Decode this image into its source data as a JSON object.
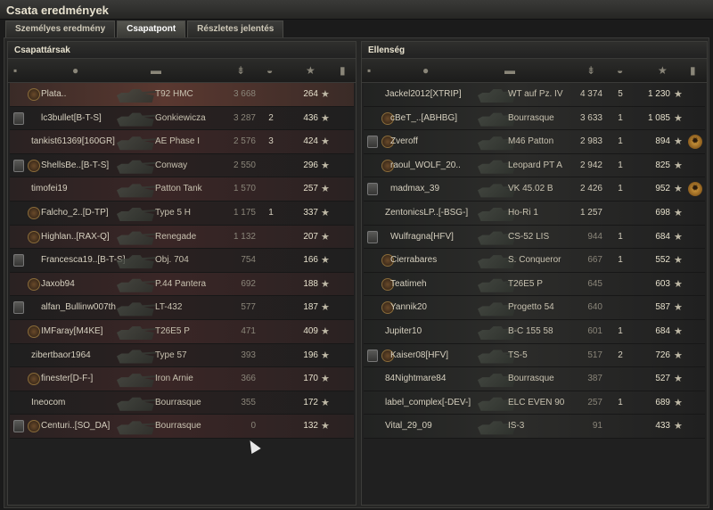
{
  "window": {
    "title": "Csata eredmények"
  },
  "tabs": [
    {
      "label": "Személyes eredmény",
      "active": false
    },
    {
      "label": "Csapatpont",
      "active": true
    },
    {
      "label": "Részletes jelentés",
      "active": false
    }
  ],
  "icons": {
    "platoon": "platoon-icon",
    "player": "player-icon",
    "tank": "tank-icon",
    "damage": "damage-icon",
    "kills": "kills-icon",
    "xp": "star-icon",
    "medal": "medal-icon"
  },
  "allies": {
    "title": "Csapattársak",
    "rows": [
      {
        "name": "Plata..",
        "tank": "T92 HMC",
        "damage": "3 668",
        "kills": "",
        "xp": "264",
        "platoon": false,
        "clan": true,
        "player": true
      },
      {
        "name": "lc3bullet[B-T-S]",
        "tank": "Gonkiewicza",
        "damage": "3 287",
        "kills": "2",
        "xp": "436",
        "platoon": true,
        "clan": false
      },
      {
        "name": "tankist61369[160GR]",
        "tank": "AE Phase I",
        "damage": "2 576",
        "kills": "3",
        "xp": "424",
        "platoon": false,
        "clan": false
      },
      {
        "name": "ShellsBe..[B-T-S]",
        "tank": "Conway",
        "damage": "2 550",
        "kills": "",
        "xp": "296",
        "platoon": true,
        "clan": true
      },
      {
        "name": "timofei19",
        "tank": "Patton Tank",
        "damage": "1 570",
        "kills": "",
        "xp": "257",
        "platoon": false,
        "clan": false
      },
      {
        "name": "Falcho_2..[D-TP]",
        "tank": "Type 5 H",
        "damage": "1 175",
        "kills": "1",
        "xp": "337",
        "platoon": false,
        "clan": true
      },
      {
        "name": "Highlan..[RAX-Q]",
        "tank": "Renegade",
        "damage": "1 132",
        "kills": "",
        "xp": "207",
        "platoon": false,
        "clan": true
      },
      {
        "name": "Francesca19..[B-T-S]",
        "tank": "Obj. 704",
        "damage": "754",
        "kills": "",
        "xp": "166",
        "platoon": true,
        "clan": false
      },
      {
        "name": "Jaxob94",
        "tank": "P.44 Pantera",
        "damage": "692",
        "kills": "",
        "xp": "188",
        "platoon": false,
        "clan": true
      },
      {
        "name": "alfan_Bullinw007th",
        "tank": "LT-432",
        "damage": "577",
        "kills": "",
        "xp": "187",
        "platoon": true,
        "clan": false
      },
      {
        "name": "IMFaray[M4KE]",
        "tank": "T26E5 P",
        "damage": "471",
        "kills": "",
        "xp": "409",
        "platoon": false,
        "clan": true
      },
      {
        "name": "zibertbaor1964",
        "tank": "Type 57",
        "damage": "393",
        "kills": "",
        "xp": "196",
        "platoon": false,
        "clan": false
      },
      {
        "name": "finester[D-F-]",
        "tank": "Iron Arnie",
        "damage": "366",
        "kills": "",
        "xp": "170",
        "platoon": false,
        "clan": true
      },
      {
        "name": "Ineocom",
        "tank": "Bourrasque",
        "damage": "355",
        "kills": "",
        "xp": "172",
        "platoon": false,
        "clan": false
      },
      {
        "name": "Centuri..[SO_DA]",
        "tank": "Bourrasque",
        "damage": "0",
        "kills": "",
        "xp": "132",
        "platoon": true,
        "clan": true
      }
    ]
  },
  "enemies": {
    "title": "Ellenség",
    "rows": [
      {
        "name": "Jackel2012[XTRIP]",
        "tank": "WT auf Pz. IV",
        "damage": "4 374",
        "kills": "5",
        "xp": "1 230",
        "platoon": false,
        "clan": false,
        "medal": false
      },
      {
        "name": "cBeT_..[ABHBG]",
        "tank": "Bourrasque",
        "damage": "3 633",
        "kills": "1",
        "xp": "1 085",
        "platoon": false,
        "clan": true,
        "medal": false
      },
      {
        "name": "Zveroff",
        "tank": "M46 Patton",
        "damage": "2 983",
        "kills": "1",
        "xp": "894",
        "platoon": true,
        "clan": true,
        "medal": true
      },
      {
        "name": "raoul_WOLF_20..",
        "tank": "Leopard PT A",
        "damage": "2 942",
        "kills": "1",
        "xp": "825",
        "platoon": false,
        "clan": true,
        "medal": false
      },
      {
        "name": "madmax_39",
        "tank": "VK 45.02 B",
        "damage": "2 426",
        "kills": "1",
        "xp": "952",
        "platoon": true,
        "clan": false,
        "medal": true
      },
      {
        "name": "ZentonicsLP..[-BSG-]",
        "tank": "Ho-Ri 1",
        "damage": "1 257",
        "kills": "",
        "xp": "698",
        "platoon": false,
        "clan": false,
        "medal": false
      },
      {
        "name": "Wulfragna[HFV]",
        "tank": "CS-52 LIS",
        "damage": "944",
        "kills": "1",
        "xp": "684",
        "platoon": true,
        "clan": false,
        "medal": false
      },
      {
        "name": "Cierrabares",
        "tank": "S. Conqueror",
        "damage": "667",
        "kills": "1",
        "xp": "552",
        "platoon": false,
        "clan": true,
        "medal": false
      },
      {
        "name": "Teatimeh",
        "tank": "T26E5 P",
        "damage": "645",
        "kills": "",
        "xp": "603",
        "platoon": false,
        "clan": true,
        "medal": false
      },
      {
        "name": "Yannik20",
        "tank": "Progetto 54",
        "damage": "640",
        "kills": "",
        "xp": "587",
        "platoon": false,
        "clan": true,
        "medal": false
      },
      {
        "name": "Jupiter10",
        "tank": "B-C 155 58",
        "damage": "601",
        "kills": "1",
        "xp": "684",
        "platoon": false,
        "clan": false,
        "medal": false
      },
      {
        "name": "Kaiser08[HFV]",
        "tank": "TS-5",
        "damage": "517",
        "kills": "2",
        "xp": "726",
        "platoon": true,
        "clan": true,
        "medal": false
      },
      {
        "name": "84Nightmare84",
        "tank": "Bourrasque",
        "damage": "387",
        "kills": "",
        "xp": "527",
        "platoon": false,
        "clan": false,
        "medal": false
      },
      {
        "name": "label_complex[-DEV-]",
        "tank": "ELC EVEN 90",
        "damage": "257",
        "kills": "1",
        "xp": "689",
        "platoon": false,
        "clan": false,
        "medal": false
      },
      {
        "name": "Vital_29_09",
        "tank": "IS-3",
        "damage": "91",
        "kills": "",
        "xp": "433",
        "platoon": false,
        "clan": false,
        "medal": false
      }
    ]
  }
}
